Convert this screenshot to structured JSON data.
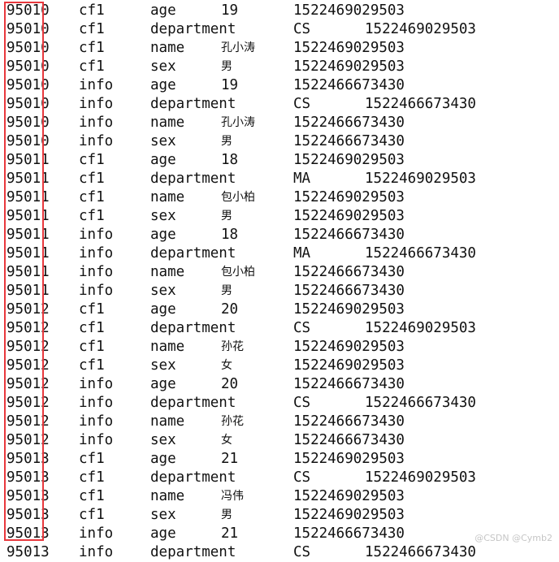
{
  "highlight_color": "#e8383d",
  "watermark": "@CSDN @Cymb2",
  "rows": [
    {
      "rowkey": "95010",
      "family": "cf1",
      "qualifier": "age",
      "value": "19",
      "timestamp": "1522469029503"
    },
    {
      "rowkey": "95010",
      "family": "cf1",
      "qualifier": "department",
      "value": "CS",
      "timestamp": "1522469029503"
    },
    {
      "rowkey": "95010",
      "family": "cf1",
      "qualifier": "name",
      "value": "孔小涛",
      "timestamp": "1522469029503"
    },
    {
      "rowkey": "95010",
      "family": "cf1",
      "qualifier": "sex",
      "value": "男",
      "timestamp": "1522469029503"
    },
    {
      "rowkey": "95010",
      "family": "info",
      "qualifier": "age",
      "value": "19",
      "timestamp": "1522466673430"
    },
    {
      "rowkey": "95010",
      "family": "info",
      "qualifier": "department",
      "value": "CS",
      "timestamp": "1522466673430"
    },
    {
      "rowkey": "95010",
      "family": "info",
      "qualifier": "name",
      "value": "孔小涛",
      "timestamp": "1522466673430"
    },
    {
      "rowkey": "95010",
      "family": "info",
      "qualifier": "sex",
      "value": "男",
      "timestamp": "1522466673430"
    },
    {
      "rowkey": "95011",
      "family": "cf1",
      "qualifier": "age",
      "value": "18",
      "timestamp": "1522469029503"
    },
    {
      "rowkey": "95011",
      "family": "cf1",
      "qualifier": "department",
      "value": "MA",
      "timestamp": "1522469029503"
    },
    {
      "rowkey": "95011",
      "family": "cf1",
      "qualifier": "name",
      "value": "包小柏",
      "timestamp": "1522469029503"
    },
    {
      "rowkey": "95011",
      "family": "cf1",
      "qualifier": "sex",
      "value": "男",
      "timestamp": "1522469029503"
    },
    {
      "rowkey": "95011",
      "family": "info",
      "qualifier": "age",
      "value": "18",
      "timestamp": "1522466673430"
    },
    {
      "rowkey": "95011",
      "family": "info",
      "qualifier": "department",
      "value": "MA",
      "timestamp": "1522466673430"
    },
    {
      "rowkey": "95011",
      "family": "info",
      "qualifier": "name",
      "value": "包小柏",
      "timestamp": "1522466673430"
    },
    {
      "rowkey": "95011",
      "family": "info",
      "qualifier": "sex",
      "value": "男",
      "timestamp": "1522466673430"
    },
    {
      "rowkey": "95012",
      "family": "cf1",
      "qualifier": "age",
      "value": "20",
      "timestamp": "1522469029503"
    },
    {
      "rowkey": "95012",
      "family": "cf1",
      "qualifier": "department",
      "value": "CS",
      "timestamp": "1522469029503"
    },
    {
      "rowkey": "95012",
      "family": "cf1",
      "qualifier": "name",
      "value": "孙花",
      "timestamp": "1522469029503"
    },
    {
      "rowkey": "95012",
      "family": "cf1",
      "qualifier": "sex",
      "value": "女",
      "timestamp": "1522469029503"
    },
    {
      "rowkey": "95012",
      "family": "info",
      "qualifier": "age",
      "value": "20",
      "timestamp": "1522466673430"
    },
    {
      "rowkey": "95012",
      "family": "info",
      "qualifier": "department",
      "value": "CS",
      "timestamp": "1522466673430"
    },
    {
      "rowkey": "95012",
      "family": "info",
      "qualifier": "name",
      "value": "孙花",
      "timestamp": "1522466673430"
    },
    {
      "rowkey": "95012",
      "family": "info",
      "qualifier": "sex",
      "value": "女",
      "timestamp": "1522466673430"
    },
    {
      "rowkey": "95013",
      "family": "cf1",
      "qualifier": "age",
      "value": "21",
      "timestamp": "1522469029503"
    },
    {
      "rowkey": "95013",
      "family": "cf1",
      "qualifier": "department",
      "value": "CS",
      "timestamp": "1522469029503"
    },
    {
      "rowkey": "95013",
      "family": "cf1",
      "qualifier": "name",
      "value": "冯伟",
      "timestamp": "1522469029503"
    },
    {
      "rowkey": "95013",
      "family": "cf1",
      "qualifier": "sex",
      "value": "男",
      "timestamp": "1522469029503"
    },
    {
      "rowkey": "95013",
      "family": "info",
      "qualifier": "age",
      "value": "21",
      "timestamp": "1522466673430"
    },
    {
      "rowkey": "95013",
      "family": "info",
      "qualifier": "department",
      "value": "CS",
      "timestamp": "1522466673430"
    }
  ]
}
